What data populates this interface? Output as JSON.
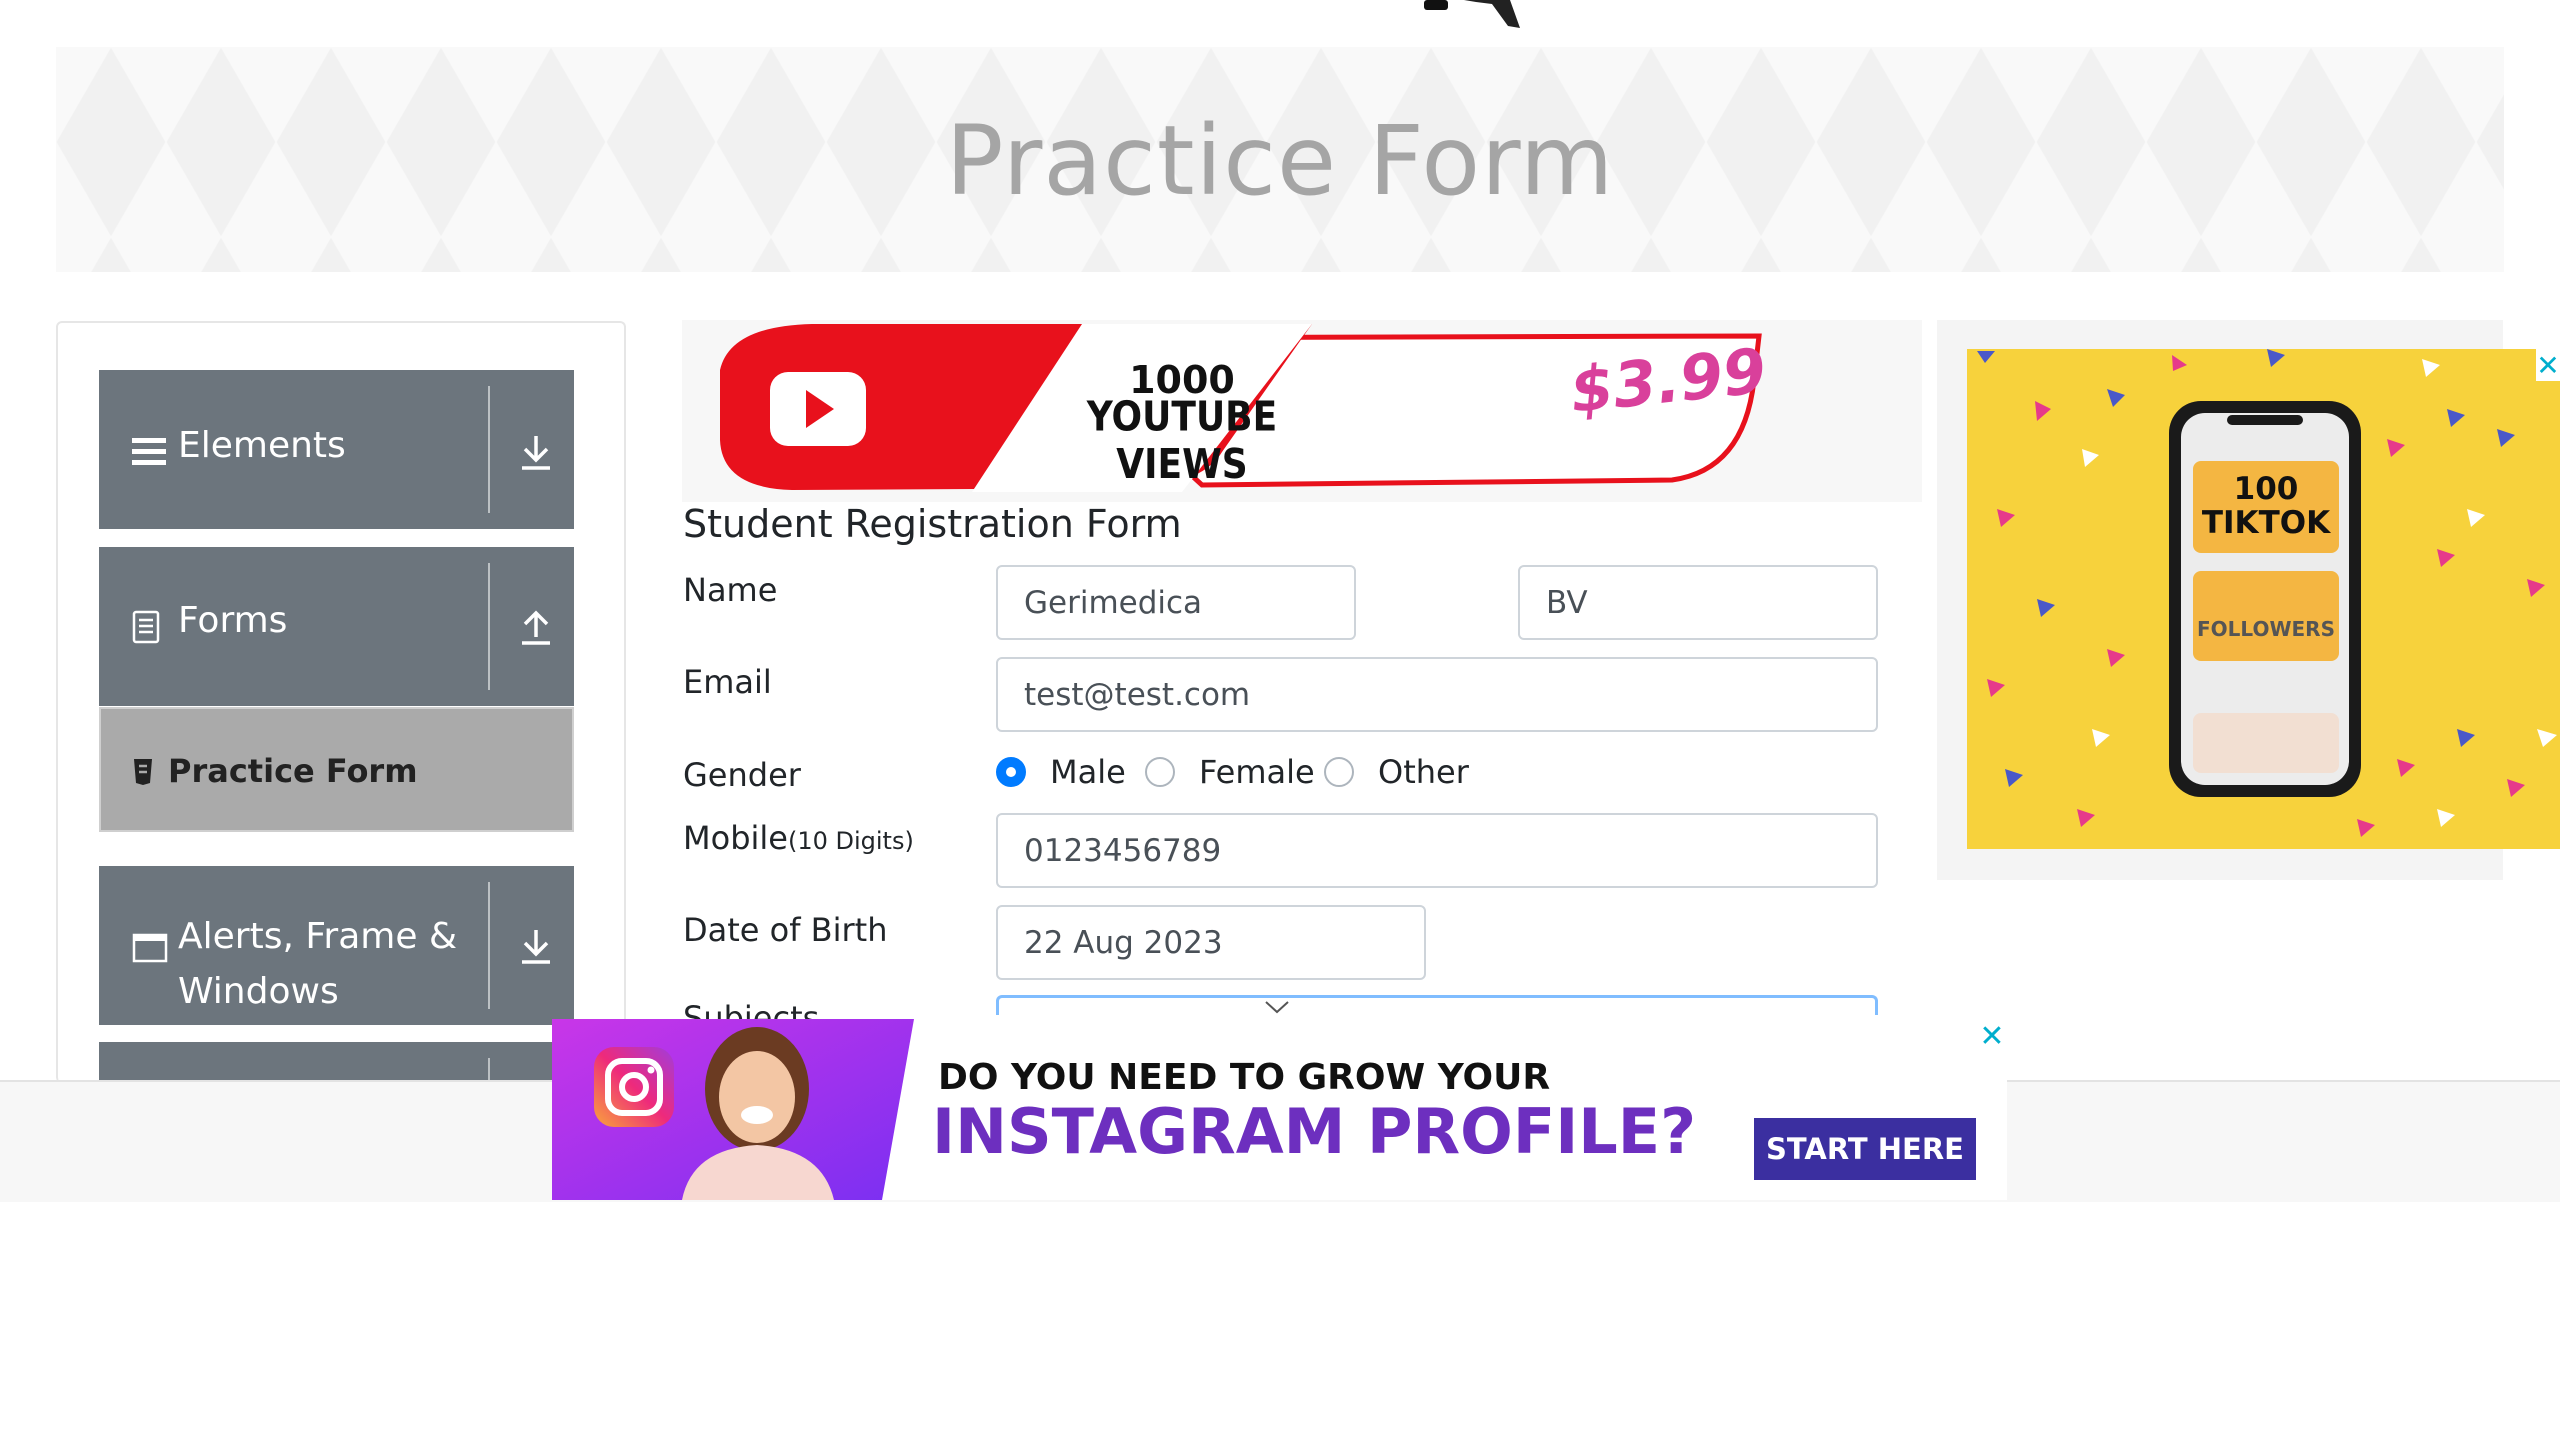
{
  "header": {
    "title": "Practice Form"
  },
  "sidebar": {
    "groups": [
      {
        "label": "Elements",
        "icon": "hamburger-icon",
        "arrow": "download-arrow-icon"
      },
      {
        "label": "Forms",
        "icon": "document-icon",
        "arrow": "upload-arrow-icon"
      },
      {
        "label_line1": "Alerts, Frame &",
        "label_line2": "Windows",
        "icon": "window-icon",
        "arrow": "download-arrow-icon"
      }
    ],
    "active_item": {
      "label": "Practice Form",
      "icon": "form-icon"
    }
  },
  "ads": {
    "youtube": {
      "line1": "1000",
      "line2": "YOUTUBE VIEWS",
      "price": "$3.99"
    },
    "tiktok": {
      "line1": "100",
      "line2": "TIKTOK",
      "line3": "FOLLOWERS",
      "close": "✕"
    },
    "instagram": {
      "line1": "DO YOU NEED TO GROW YOUR",
      "line2": "INSTAGRAM PROFILE?",
      "cta": "START HERE",
      "close": "✕"
    }
  },
  "form": {
    "title": "Student Registration Form",
    "name_label": "Name",
    "first_name": "Gerimedica",
    "last_name": "BV",
    "email_label": "Email",
    "email": "test@test.com",
    "gender_label": "Gender",
    "gender_options": [
      "Male",
      "Female",
      "Other"
    ],
    "gender_selected": "Male",
    "mobile_label": "Mobile",
    "mobile_hint": "(10 Digits)",
    "mobile": "0123456789",
    "dob_label": "Date of Birth",
    "dob": "22 Aug 2023",
    "subjects_label": "Subjects"
  },
  "colors": {
    "sidebar_group": "#6c757d",
    "sidebar_active": "#aaaaaa",
    "radio_checked": "#007bff",
    "focus_border": "#80bdff",
    "tiktok_bg": "#f7d23c",
    "instagram_purple": "#9b2bf0",
    "cta_blue": "#3b2fa0",
    "youtube_red": "#e8111c"
  }
}
